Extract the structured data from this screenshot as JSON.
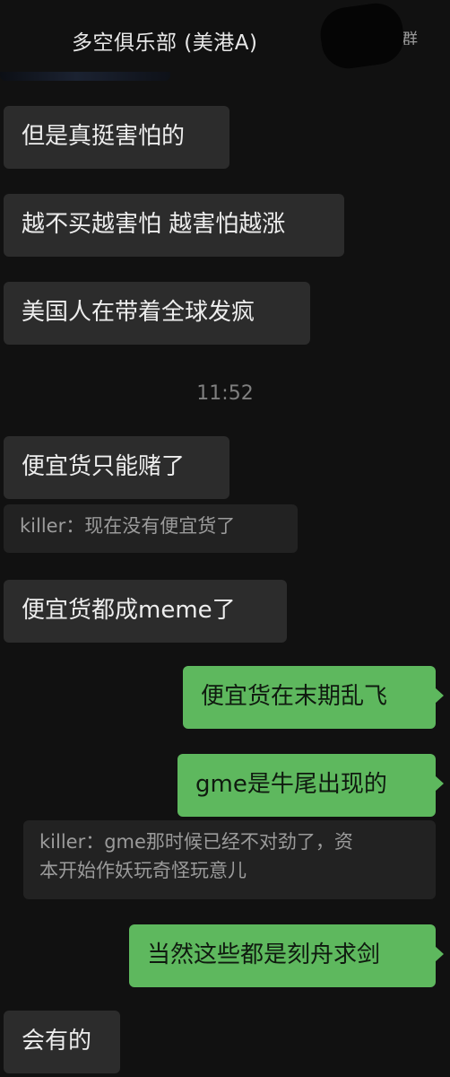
{
  "header": {
    "title": "多空俱乐部 (美港A) ",
    "suffix_glyph": "群"
  },
  "messages": [
    {
      "side": "left",
      "text": "但是真挺害怕的"
    },
    {
      "side": "left",
      "text": "越不买越害怕 越害怕越涨"
    },
    {
      "side": "left",
      "text": "美国人在带着全球发疯"
    },
    {
      "side": "left",
      "text": "便宜货只能赌了"
    },
    {
      "side": "left",
      "text": "便宜货都成meme了"
    },
    {
      "side": "right",
      "text": "便宜货在末期乱飞"
    },
    {
      "side": "right",
      "text": "gme是牛尾出现的"
    },
    {
      "side": "right",
      "text": "当然这些都是刻舟求剑"
    },
    {
      "side": "left",
      "text": "会有的"
    }
  ],
  "quotes": [
    {
      "text": "killer：现在没有便宜货了"
    },
    {
      "line1": "killer：gme那时候已经不对劲了，资",
      "line2": "本开始作妖玩奇怪玩意儿"
    }
  ],
  "timestamp": "11:52"
}
